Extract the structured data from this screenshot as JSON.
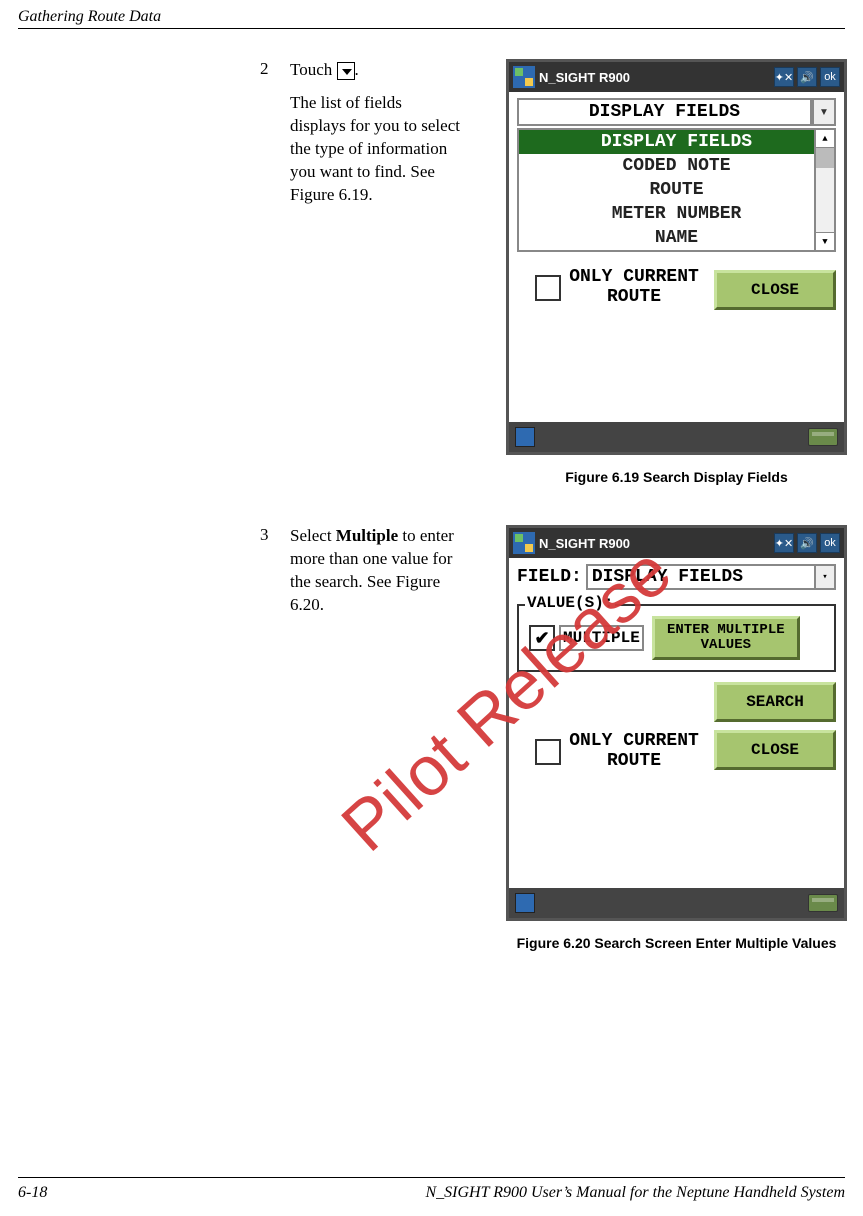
{
  "header": {
    "title": "Gathering Route Data"
  },
  "step2": {
    "number": "2",
    "touch_prefix": "Touch ",
    "touch_suffix": ".",
    "para": "The list of fields displays for you to select the type of information you want to find. See Figure 6.19."
  },
  "step3": {
    "number": "3",
    "select_prefix": "Select ",
    "select_bold": "Multiple",
    "select_suffix": " to enter more than one value for the search. See Figure 6.20."
  },
  "screenshot1": {
    "title": "N_SIGHT R900",
    "ok": "ok",
    "dropdown_selected": "DISPLAY FIELDS",
    "items": [
      "DISPLAY FIELDS",
      "CODED NOTE",
      "ROUTE",
      "METER NUMBER",
      "NAME"
    ],
    "only_current": "ONLY CURRENT ROUTE",
    "close": "CLOSE"
  },
  "screenshot2": {
    "title": "N_SIGHT R900",
    "ok": "ok",
    "field_label": "FIELD:",
    "field_value": "DISPLAY FIELDS",
    "values_label": "VALUE(S):",
    "multiple": "MULTIPLE",
    "enter_multiple": "ENTER MULTIPLE VALUES",
    "search": "SEARCH",
    "close": "CLOSE",
    "only_current": "ONLY CURRENT ROUTE"
  },
  "captions": {
    "fig619": "Figure 6.19   Search Display Fields",
    "fig620": "Figure 6.20   Search Screen Enter Multiple Values"
  },
  "watermark": "Pilot Release",
  "footer": {
    "page": "6-18",
    "title": "N_SIGHT R900 User’s Manual for the Neptune Handheld System"
  }
}
